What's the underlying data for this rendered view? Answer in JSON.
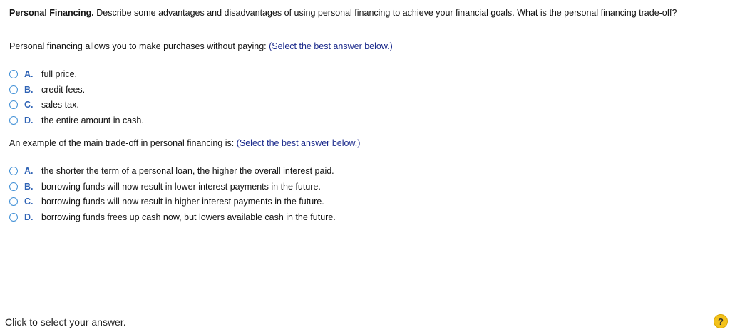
{
  "question": {
    "title": "Personal Financing.",
    "text": "Describe some advantages and disadvantages of using personal financing to achieve your financial goals. What is the personal financing trade-off?"
  },
  "part1": {
    "prompt": "Personal financing allows you to make purchases without paying:",
    "hint": "(Select the best answer below.)",
    "options": [
      {
        "letter": "A.",
        "text": "full price."
      },
      {
        "letter": "B.",
        "text": "credit fees."
      },
      {
        "letter": "C.",
        "text": "sales tax."
      },
      {
        "letter": "D.",
        "text": "the entire amount in cash."
      }
    ]
  },
  "part2": {
    "prompt": "An example of the main trade-off in personal financing is:",
    "hint": "(Select the best answer below.)",
    "options": [
      {
        "letter": "A.",
        "text": "the shorter the term of a personal loan, the higher the overall interest paid."
      },
      {
        "letter": "B.",
        "text": "borrowing funds will now result in lower interest payments in the future."
      },
      {
        "letter": "C.",
        "text": "borrowing funds will now result in higher interest payments in the future."
      },
      {
        "letter": "D.",
        "text": "borrowing funds frees up cash now, but lowers available cash in the future."
      }
    ]
  },
  "footer": {
    "instruction": "Click to select your answer.",
    "help_label": "?"
  },
  "colors": {
    "accent": "#2f63b5",
    "hint": "#1b2a8c",
    "radio_border": "#3f8fd6",
    "help_badge": "#f3c21c"
  }
}
